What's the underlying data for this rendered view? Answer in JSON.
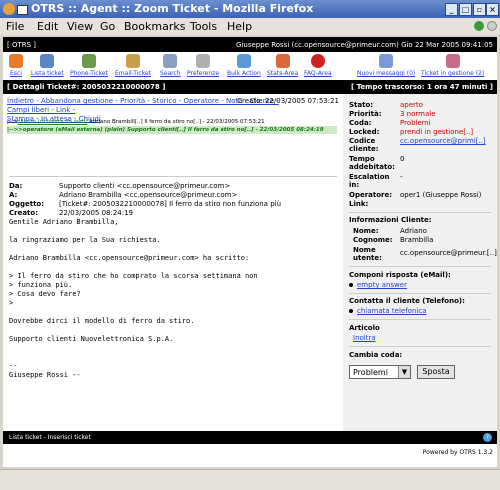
{
  "window": {
    "title": "OTRS :: Agent :: Zoom Ticket - Mozilla Firefox"
  },
  "menu": {
    "file": "File",
    "edit": "Edit",
    "view": "View",
    "go": "Go",
    "bookmarks": "Bookmarks",
    "tools": "Tools",
    "help": "Help"
  },
  "header": {
    "brand": "[ OTRS ]",
    "user_info": "Giuseppe Rossi (cc.opensource@primeur.com) Gio 22 Mar 2005 09:41:05"
  },
  "toolbar": {
    "esci": "Esci",
    "lista": "Lista ticket",
    "phone": "Phone-Ticket",
    "email": "Email-Ticket",
    "search": "Search",
    "pref": "Preferenze",
    "bulk": "Bulk Action",
    "stats": "Stats-Area",
    "faq": "FAQ-Area",
    "newmsg": "Nuovi messaggi (0)",
    "inprogress": "Ticket in gestione (2)"
  },
  "ticket_header": {
    "title": "[ Dettagli Ticket#: 2005032210000078 ]",
    "elapsed": "[ Tempo trascorso: 1 ora 47 minuti ]"
  },
  "nav": {
    "links_line1": "Indietro - Abbandona gestione - Priorità - Storico - Operatore - Nota - Cliente - Campi liberi - Link -",
    "links_line2": "Stampa - In attesa - Chiudi",
    "created": "Creato: 22/03/2005 07:53:21"
  },
  "thread": {
    "row1_prefix": "|-->",
    "row1_link": "cliente (richiesta da web)",
    "row1_text": " Adriano Brambill[..] Il ferro da stiro no[..] - 22/03/2005 07:53:21",
    "row2": "|-->>operatore (eMail esterna) (plain) Supporto clienti[..] Il ferro da stiro no[..] - 22/03/2005 08:24:19"
  },
  "article": {
    "da_label": "Da:",
    "da": "Supporto clienti <cc.opensource@primeur.com>",
    "a_label": "A:",
    "a": "Adriano Brambilla <cc.opensource@primeur.com>",
    "oggetto_label": "Oggetto:",
    "oggetto": "[Ticket#: 2005032210000078] Il ferro da stiro non funziona più",
    "creato_label": "Creato:",
    "creato": "22/03/2005 08:24:19",
    "body": "Gentile Adriano Brambilla,\n\nla ringraziamo per la Sua richiesta.\n\nAdriano Brambilla <cc.opensource@primeur.com> ha scritto:\n\n> Il ferro da stiro che ho comprato la scorsa settimana non\n> funziona più.\n> Cosa devo fare?\n>\n\nDovrebbe dirci il modello di ferro da stiro.\n\nSupporto clienti Nuovelettronica S.p.A.\n\n\n--\nGiuseppe Rossi --"
  },
  "info": {
    "stato_label": "Stato:",
    "stato": "aperto",
    "priorita_label": "Priorità:",
    "priorita": "3 normale",
    "coda_label": "Coda:",
    "coda": "Problemi",
    "locked_label": "Locked:",
    "locked": "prendi in gestione[..]",
    "codice_label": "Codice cliente:",
    "codice": "cc.opensource@primi[..]",
    "tempo_label": "Tempo addebitato:",
    "tempo": "0",
    "escal_label": "Escalation in:",
    "escal": "-",
    "operatore_label": "Operatore:",
    "operatore": "oper1 (Giuseppe Rossi)",
    "link_label": "Link:",
    "cliente_title": "Informazioni Cliente:",
    "nome_label": "Nome:",
    "nome": "Adriano",
    "cognome_label": "Cognome:",
    "cognome": "Brambilla",
    "utente_label": "Nome utente:",
    "utente": "cc.opensource@primeur.[..]",
    "componi_title": "Componi risposta (eMail):",
    "componi_link": "empty answer",
    "contatta_title": "Contatta il cliente (Telefono):",
    "contatta_link": "chiamata telefonica",
    "articolo_title": "Articolo",
    "inoltra": "Inoltra",
    "cambia_title": "Cambia coda:",
    "queue_selected": "Problemi",
    "sposta": "Sposta"
  },
  "footer": {
    "links": "Lista ticket - Inserisci ticket",
    "powered": "Powered by OTRS 1.3.2"
  },
  "colors": {
    "title_bar": "#3c62b4",
    "header_black": "#000000",
    "link": "#2244cc",
    "alert_red": "#cc0000",
    "thread_green": "#117711"
  }
}
